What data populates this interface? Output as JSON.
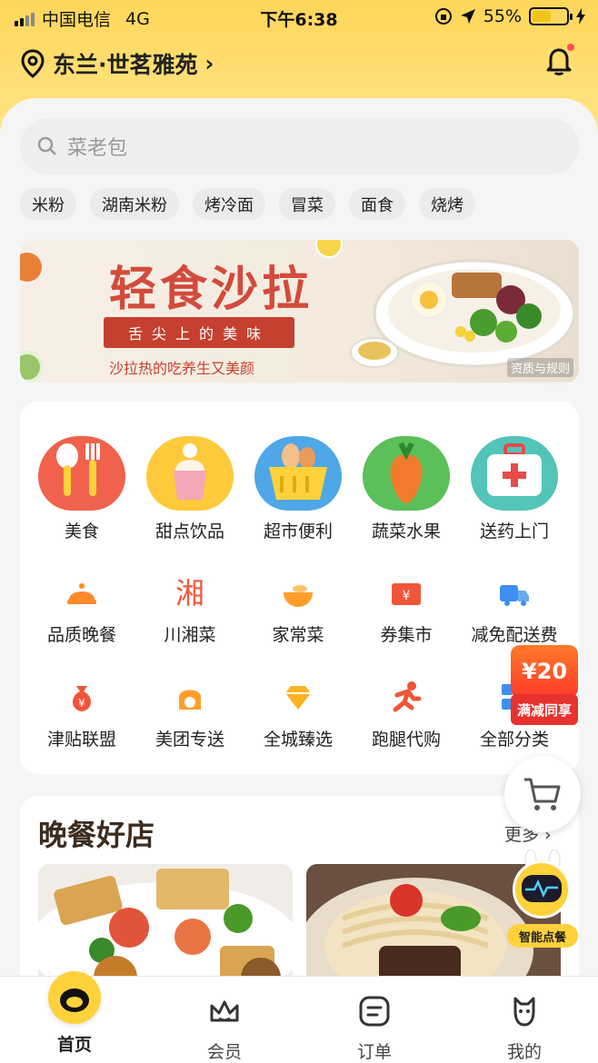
{
  "status_bar": {
    "carrier": "中国电信",
    "network": "4G",
    "time": "下午6:38",
    "battery": "55%",
    "battery_level": 0.55
  },
  "header": {
    "location": "东兰·世茗雅苑",
    "location_icon": "map-pin-icon",
    "notification_icon": "bell-icon"
  },
  "search": {
    "placeholder": "菜老包"
  },
  "chips": [
    "米粉",
    "湖南米粉",
    "烤冷面",
    "冒菜",
    "面食",
    "烧烤"
  ],
  "banner": {
    "title": "轻食沙拉",
    "ribbon": "舌尖上的美味",
    "tagline": "沙拉热的吃养生又美颜",
    "rules": "资质与规则"
  },
  "categories_big": [
    {
      "label": "美食",
      "color": "#f0624d"
    },
    {
      "label": "甜点饮品",
      "color": "#ffc93c"
    },
    {
      "label": "超市便利",
      "color": "#4fa7e8"
    },
    {
      "label": "蔬菜水果",
      "color": "#5bbf5a"
    },
    {
      "label": "送药上门",
      "color": "#52c4b8"
    }
  ],
  "categories_small_row1": [
    {
      "label": "品质晚餐",
      "color": "#ff8a2b"
    },
    {
      "label": "川湘菜",
      "color": "#f05a3a"
    },
    {
      "label": "家常菜",
      "color": "#ff9e2b"
    },
    {
      "label": "券集市",
      "color": "#f0553a"
    },
    {
      "label": "减免配送费",
      "color": "#3d8ff0"
    }
  ],
  "categories_small_row2": [
    {
      "label": "津贴联盟",
      "color": "#f0553a"
    },
    {
      "label": "美团专送",
      "color": "#ff9e2b"
    },
    {
      "label": "全城臻选",
      "color": "#ffb324"
    },
    {
      "label": "跑腿代购",
      "color": "#f0553a"
    },
    {
      "label": "全部分类",
      "color": "#3d8ff0"
    }
  ],
  "promo": {
    "amount": "¥20",
    "label": "满减同享"
  },
  "section": {
    "title": "晚餐好店",
    "more": "更多 ›"
  },
  "assistant": {
    "label": "智能点餐"
  },
  "tabbar": [
    {
      "label": "首页",
      "icon": "home-icon"
    },
    {
      "label": "会员",
      "icon": "crown-icon"
    },
    {
      "label": "订单",
      "icon": "order-icon"
    },
    {
      "label": "我的",
      "icon": "profile-icon"
    }
  ],
  "colors": {
    "brand_yellow": "#ffd13a",
    "accent_red": "#d24b3c"
  }
}
